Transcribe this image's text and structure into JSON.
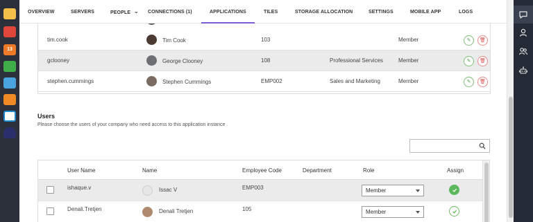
{
  "dock": {
    "apps": [
      {
        "name": "notes-app-icon",
        "color": "#f5c04a"
      },
      {
        "name": "mail-app-icon",
        "color": "#e0463a"
      },
      {
        "name": "calendar-app-icon",
        "color": "#ee7a28",
        "text": "13"
      },
      {
        "name": "list-app-icon",
        "color": "#3fae49"
      },
      {
        "name": "photo-app-icon",
        "color": "#4aa3df"
      },
      {
        "name": "draw-app-icon",
        "color": "#f08a24"
      },
      {
        "name": "wave-app-icon",
        "color": "#1e8bd1"
      },
      {
        "name": "arc-app-icon",
        "color": "#2b2f6b"
      }
    ]
  },
  "nav": {
    "tabs": [
      {
        "label": "OVERVIEW"
      },
      {
        "label": "SERVERS"
      },
      {
        "label": "PEOPLE"
      },
      {
        "label": "CONNECTIONS (1)"
      },
      {
        "label": "APPLICATIONS"
      },
      {
        "label": "TILES"
      },
      {
        "label": "STORAGE ALLOCATION"
      },
      {
        "label": "SETTINGS"
      },
      {
        "label": "MOBILE APP"
      },
      {
        "label": "LOGS"
      }
    ],
    "active": "APPLICATIONS"
  },
  "groups_table": {
    "rows": [
      {
        "username": "tim.cook",
        "name": "Tim Cook",
        "code": "103",
        "department": "",
        "role": "Member"
      },
      {
        "username": "gclooney",
        "name": "George Clooney",
        "code": "108",
        "department": "Professional Services",
        "role": "Member"
      },
      {
        "username": "stephen.cummings",
        "name": "Stephen Cummings",
        "code": "EMP002",
        "department": "Sales and Marketing",
        "role": "Member"
      }
    ]
  },
  "users": {
    "title": "Users",
    "subtitle": "Please choose the users of your company who need access to this application instance",
    "search_placeholder": "",
    "headers": {
      "username": "User Name",
      "name": "Name",
      "code": "Employee Code",
      "department": "Department",
      "role": "Role",
      "assign": "Assign"
    },
    "rows": [
      {
        "username": "ishaque.v",
        "name": "Issac V",
        "code": "EMP003",
        "department": "",
        "role": "Member",
        "assigned": true
      },
      {
        "username": "Denali.Tretjen",
        "name": "Denali Tretjen",
        "code": "105",
        "department": "",
        "role": "Member",
        "assigned": false
      }
    ]
  },
  "colors": {
    "accent": "#7b5cd6",
    "success": "#5cb85c",
    "danger": "#d9534f"
  }
}
